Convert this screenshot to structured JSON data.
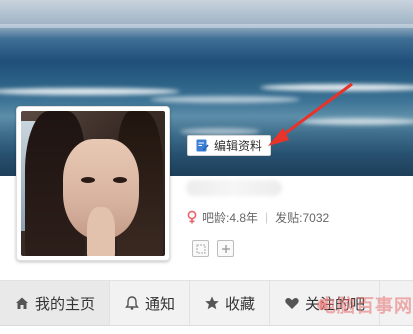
{
  "profile": {
    "edit_button_label": "编辑资料",
    "bar_age": "吧龄:4.8年",
    "post_count": "发贴:7032"
  },
  "nav": {
    "tabs": [
      {
        "label": "我的主页",
        "icon": "home-icon",
        "active": true
      },
      {
        "label": "通知",
        "icon": "bell-icon",
        "active": false
      },
      {
        "label": "收藏",
        "icon": "star-icon",
        "active": false
      },
      {
        "label": "关注的吧",
        "icon": "heart-icon",
        "active": false
      }
    ]
  },
  "watermark": "电脑百事网",
  "colors": {
    "annotation_arrow": "#e8322a",
    "gender_female": "#e8646e",
    "nav_background": "#f2f2f2"
  }
}
